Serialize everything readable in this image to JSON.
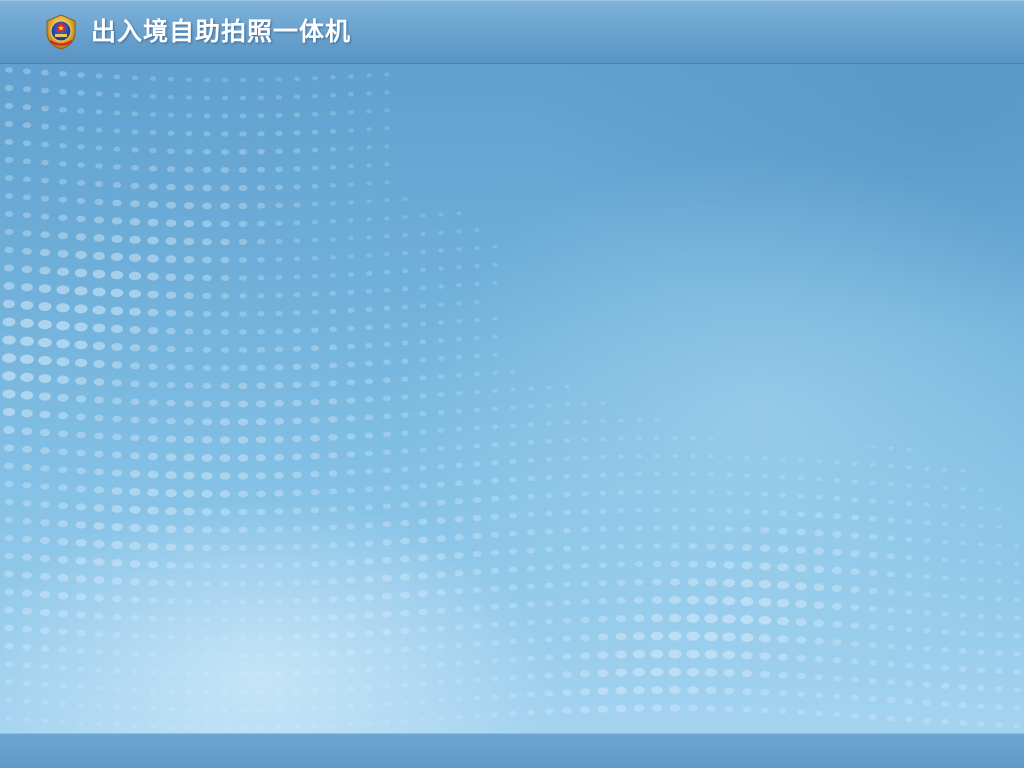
{
  "header": {
    "title": "出入境自助拍照一体机",
    "emblem_icon": "police-emblem-icon"
  },
  "theme": {
    "header_color": "#6aa3cf",
    "footer_color": "#6199c6",
    "background_color": "#6eaed8",
    "dot_color": "#d6ecfa"
  }
}
